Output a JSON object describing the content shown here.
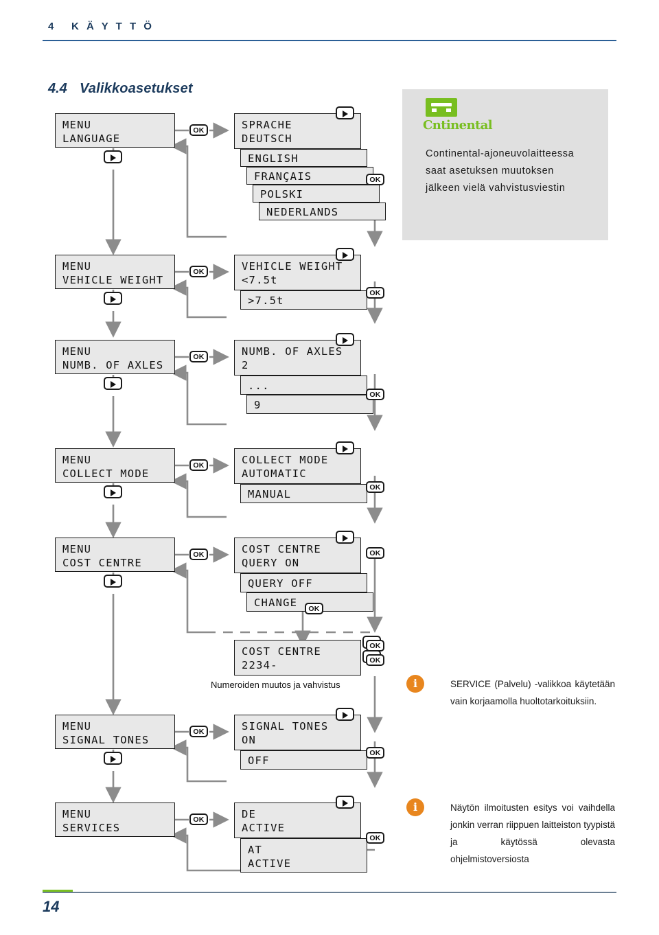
{
  "header": {
    "chapter_number": "4",
    "chapter_title": "K Ä Y T T Ö"
  },
  "section": {
    "number": "4.4",
    "title": "Valikkoasetukset"
  },
  "footer": {
    "page_number": "14"
  },
  "continental_note": {
    "logo_word": "ntinental",
    "text": "Continental-ajoneuvolaitteessa saat asetuksen muutoksen jälkeen vielä vahvistusviestin"
  },
  "notes": [
    {
      "icon": "info-icon",
      "symbol": "i",
      "text": "SERVICE (Palvelu) -valikkoa käytetään vain korjaamolla huoltotarkoituksiin."
    },
    {
      "icon": "info-icon",
      "symbol": "i",
      "text": "Näytön ilmoitusten esitys voi vaihdella jonkin verran riippuen laitteiston tyypistä ja käytössä olevasta ohjelmistoversiosta"
    }
  ],
  "keys": {
    "ok": "OK",
    "right_arrow": "right-arrow",
    "up_arrow": "up-arrow",
    "down_arrow": "down-arrow"
  },
  "captions": {
    "cost_centre_entry": "Numeroiden muutos ja vahvistus"
  },
  "menu_flow": [
    {
      "id": "language",
      "menu_line1": "MENU",
      "menu_line2": "LANGUAGE",
      "detail_line1": "SPRACHE",
      "detail_line2": "DEUTSCH",
      "options": [
        "ENGLISH",
        "FRANÇAIS",
        "POLSKI",
        "NEDERLANDS"
      ]
    },
    {
      "id": "vehicle-weight",
      "menu_line1": "MENU",
      "menu_line2": "VEHICLE WEIGHT",
      "detail_line1": "VEHICLE WEIGHT",
      "detail_line2": "<7.5t",
      "options": [
        ">7.5t"
      ]
    },
    {
      "id": "numb-of-axles",
      "menu_line1": "MENU",
      "menu_line2": "NUMB. OF AXLES",
      "detail_line1": "NUMB. OF AXLES",
      "detail_line2": "2",
      "options": [
        "...",
        "9"
      ]
    },
    {
      "id": "collect-mode",
      "menu_line1": "MENU",
      "menu_line2": "COLLECT MODE",
      "detail_line1": "COLLECT MODE",
      "detail_line2": "AUTOMATIC",
      "options": [
        "MANUAL"
      ]
    },
    {
      "id": "cost-centre",
      "menu_line1": "MENU",
      "menu_line2": "COST CENTRE",
      "detail_line1": "COST CENTRE",
      "detail_line2": "QUERY ON",
      "options": [
        "QUERY OFF",
        "CHANGE"
      ],
      "entry_line1": "COST CENTRE",
      "entry_line2": "2234-"
    },
    {
      "id": "signal-tones",
      "menu_line1": "MENU",
      "menu_line2": "SIGNAL TONES",
      "detail_line1": "SIGNAL TONES",
      "detail_line2": "ON",
      "options": [
        "OFF"
      ]
    },
    {
      "id": "services",
      "menu_line1": "MENU",
      "menu_line2": "SERVICES",
      "detail_line1": "DE",
      "detail_line2": "ACTIVE",
      "options_two_line": [
        {
          "line1": "AT",
          "line2": "ACTIVE"
        }
      ]
    }
  ],
  "colors": {
    "accent_blue": "#1b3a5c",
    "rule_blue": "#2b5f96",
    "brand_green": "#78be20",
    "note_orange": "#e8861e",
    "lcd_bg": "#e8e8e8",
    "wire_grey": "#8c8c8c"
  }
}
